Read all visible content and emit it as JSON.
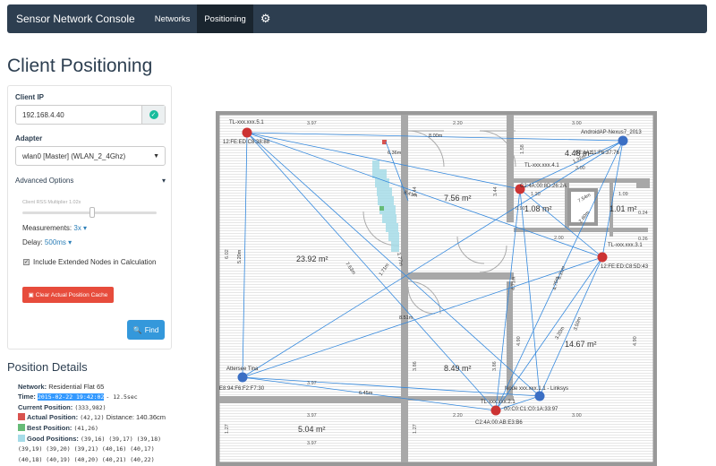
{
  "nav": {
    "brand": "Sensor Network Console",
    "items": [
      "Networks",
      "Positioning"
    ],
    "active": "Positioning",
    "settings_icon": "gear-icon"
  },
  "page": {
    "title": "Client Positioning"
  },
  "form": {
    "client_ip_label": "Client IP",
    "client_ip_value": "192.168.4.40",
    "adapter_label": "Adapter",
    "adapter_value": "wlan0 [Master] (WLAN_2_4Ghz)",
    "advanced_label": "Advanced Options",
    "rss_label": "Client RSS Multiplier 1.02x",
    "rss_multiplier": 1.02,
    "measurements_label": "Measurements:",
    "measurements_value": "3x",
    "delay_label": "Delay:",
    "delay_value": "500ms",
    "extended_label": "Include Extended Nodes in Calculation",
    "extended_checked": true,
    "clear_button": "Clear Actual Position Cache",
    "find_button": "Find"
  },
  "details": {
    "heading": "Position Details",
    "network_label": "Network:",
    "network_value": "Residential Flat 65",
    "time_label": "Time:",
    "time_value": "2015-02-22 19:42:02",
    "time_extra": "- 12.5sec",
    "current_label": "Current Position:",
    "current_value": "(333,982)",
    "actual_label": "Actual Position:",
    "actual_value": "(42,12)",
    "distance_label": "Distance:",
    "distance_value": "140.36cm",
    "best_label": "Best Position:",
    "best_value": "(41,26)",
    "good_label": "Good Positions:",
    "good_line1": "(39,16) (39,17) (39,18)",
    "good_line2": "(39,19) (39,20) (39,21) (40,16) (40,17)",
    "good_line3": "(40,18) (40,19) (40,20) (40,21) (40,22)"
  },
  "map": {
    "rooms": [
      {
        "area": "23.92 m²"
      },
      {
        "area": "7.56 m²"
      },
      {
        "area": "4.48 m²"
      },
      {
        "area": "1.08 m²"
      },
      {
        "area": "1.01 m²"
      },
      {
        "area": "14.67 m²"
      },
      {
        "area": "8.49 m²"
      },
      {
        "area": "5.04 m²"
      }
    ],
    "dimensions": [
      "3.97",
      "2.20",
      "3.00",
      "3.00",
      "1.20",
      "0.90",
      "1.09",
      "0.24",
      "0.26",
      "2.00",
      "6.02",
      "3.44",
      "3.44",
      "1.58",
      "4.90",
      "4.90",
      "3.86",
      "3.86",
      "3.97",
      "3.97",
      "2.20",
      "3.00",
      "1.27",
      "1.27",
      "3.97"
    ],
    "nodes": [
      {
        "name": "TL-xxx.xxx.5.1",
        "mac": "12:FE:ED:C8:38:88",
        "type": "actual"
      },
      {
        "name": "AndroidAP-Nexus7_2013",
        "mac": "02:1A:11:F6:37:76",
        "type": "extended"
      },
      {
        "name": "TL-xxx.xxx.4.1",
        "mac": "C2:4A:00:8D:26:2A",
        "type": "actual"
      },
      {
        "name": "TL-xxx.xxx.3.1",
        "mac": "12:FE:ED:C8:5D:43",
        "type": "actual"
      },
      {
        "name": "Attersee Tina",
        "mac": "E8:94:F6:F2:F7:30",
        "type": "extended"
      },
      {
        "name": "TL-xxx.xxx.2.1",
        "mac": "C2:4A:00:AB:E3:B6",
        "type": "actual"
      },
      {
        "name": "Node xxx.xxx.1.1 - Linksys",
        "mac": "00:C0:C1:C0:1A:33:97",
        "type": "extended"
      }
    ],
    "distances": [
      "8.00m",
      "6.36m",
      "1.77m",
      "8.41m",
      "5.20m",
      "7.63m",
      "1.71m",
      "4.71m",
      "8.51m",
      "6.45m",
      "4.75m",
      "3.20m",
      "3.50m",
      "6.31m",
      "1.32m",
      "2.60m",
      "7.54m"
    ],
    "colors": {
      "actual_node": "#cc3333",
      "extended_node": "#3b6fc4",
      "line": "#3388dd",
      "good": "#a6dce8",
      "best": "#66bb77",
      "actual_pos": "#d9534f"
    }
  }
}
